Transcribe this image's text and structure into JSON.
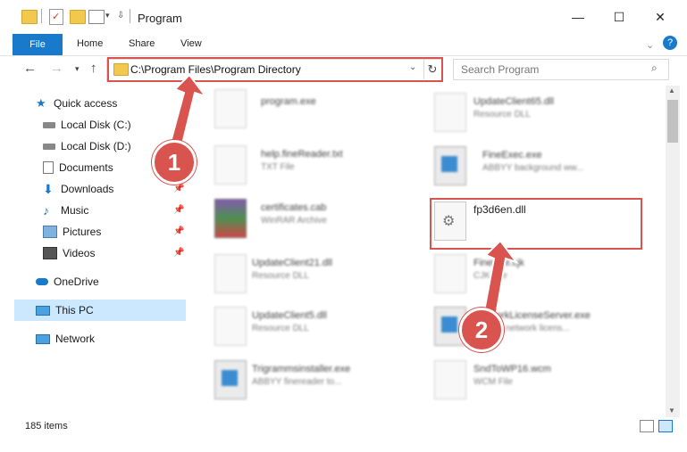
{
  "window": {
    "title": "Program",
    "controls": {
      "minimize": "—",
      "maximize": "☐",
      "close": "✕"
    },
    "help": "?"
  },
  "ribbon": {
    "tabs": [
      "File",
      "Home",
      "Share",
      "View"
    ]
  },
  "navigation": {
    "address": "C:\\Program Files\\Program Directory",
    "search_placeholder": "Search Program"
  },
  "sidebar": {
    "items": [
      {
        "label": "Quick access",
        "icon": "star-icon",
        "pinned": false
      },
      {
        "label": "Local Disk (C:)",
        "icon": "drive-icon",
        "pinned": false
      },
      {
        "label": "Local Disk (D:)",
        "icon": "drive-icon",
        "pinned": false
      },
      {
        "label": "Documents",
        "icon": "documents-icon",
        "pinned": false
      },
      {
        "label": "Downloads",
        "icon": "download-icon",
        "pinned": true
      },
      {
        "label": "Music",
        "icon": "music-icon",
        "pinned": true
      },
      {
        "label": "Pictures",
        "icon": "pictures-icon",
        "pinned": true
      },
      {
        "label": "Videos",
        "icon": "videos-icon",
        "pinned": true
      },
      {
        "label": "OneDrive",
        "icon": "cloud-icon",
        "pinned": false
      },
      {
        "label": "This PC",
        "icon": "computer-icon",
        "pinned": false,
        "selected": true
      },
      {
        "label": "Network",
        "icon": "network-icon",
        "pinned": false
      }
    ]
  },
  "files": {
    "left": [
      {
        "name": "program.exe",
        "desc": ""
      },
      {
        "name": "help.fineReader.txt",
        "desc": "TXT File"
      },
      {
        "name": "certificates.cab",
        "desc": "WinRAR Archive"
      },
      {
        "name": "UpdateClient21.dll",
        "desc": "Resource DLL"
      },
      {
        "name": "UpdateClient5.dll",
        "desc": "Resource DLL"
      },
      {
        "name": "Trigrammsinstaller.exe",
        "desc": "ABBYY finereader to..."
      }
    ],
    "right": [
      {
        "name": "UpdateClient65.dll",
        "desc": "Resource DLL"
      },
      {
        "name": "FineExec.exe",
        "desc": "ABBYY background ww..."
      },
      {
        "name": "fp3d6en.dll",
        "desc": ""
      },
      {
        "name": "FineEml.cjk",
        "desc": "CJK File"
      },
      {
        "name": "NetworkLicenseServer.exe",
        "desc": "ABBYY network licens..."
      },
      {
        "name": "SndToWP16.wcm",
        "desc": "WCM File"
      }
    ]
  },
  "status": {
    "count": "185 items"
  },
  "annotations": {
    "step1": "1",
    "step2": "2"
  }
}
